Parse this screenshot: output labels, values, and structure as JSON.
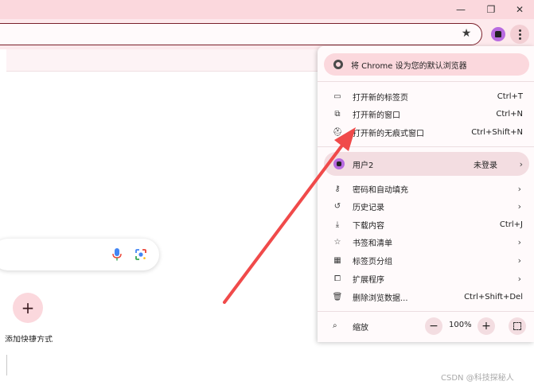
{
  "window": {
    "minimize_glyph": "—",
    "restore_glyph": "❐",
    "close_glyph": "✕"
  },
  "toolbar": {
    "star_icon": "star-icon",
    "menu_icon": "kebab-menu-icon"
  },
  "newtab": {
    "add_shortcut_glyph": "+",
    "add_shortcut_label": "添加快捷方式"
  },
  "menu": {
    "banner": "将 Chrome 设为您的默认浏览器",
    "items_group1": [
      {
        "label": "打开新的标签页",
        "shortcut": "Ctrl+T",
        "icon": "new-tab-icon"
      },
      {
        "label": "打开新的窗口",
        "shortcut": "Ctrl+N",
        "icon": "new-window-icon"
      },
      {
        "label": "打开新的无痕式窗口",
        "shortcut": "Ctrl+Shift+N",
        "icon": "incognito-icon"
      }
    ],
    "profile": {
      "label": "用户2",
      "status": "未登录"
    },
    "items_group2": [
      {
        "label": "密码和自动填充",
        "shortcut": "",
        "submenu": true,
        "icon": "key-icon"
      },
      {
        "label": "历史记录",
        "shortcut": "",
        "submenu": true,
        "icon": "history-icon"
      },
      {
        "label": "下载内容",
        "shortcut": "Ctrl+J",
        "submenu": false,
        "icon": "download-icon"
      },
      {
        "label": "书签和清单",
        "shortcut": "",
        "submenu": true,
        "icon": "bookmark-star-icon"
      },
      {
        "label": "标签页分组",
        "shortcut": "",
        "submenu": true,
        "icon": "tab-groups-icon"
      },
      {
        "label": "扩展程序",
        "shortcut": "",
        "submenu": true,
        "icon": "extension-icon"
      },
      {
        "label": "删除浏览数据...",
        "shortcut": "Ctrl+Shift+Del",
        "submenu": false,
        "icon": "trash-icon"
      }
    ],
    "zoom": {
      "label": "缩放",
      "minus": "−",
      "value": "100%",
      "plus": "+"
    }
  },
  "watermark": "CSDN @科技探秘人",
  "colors": {
    "frame": "#fbd8dd",
    "annotation_arrow": "#f04a4a",
    "profile_avatar": "#b86be0"
  }
}
